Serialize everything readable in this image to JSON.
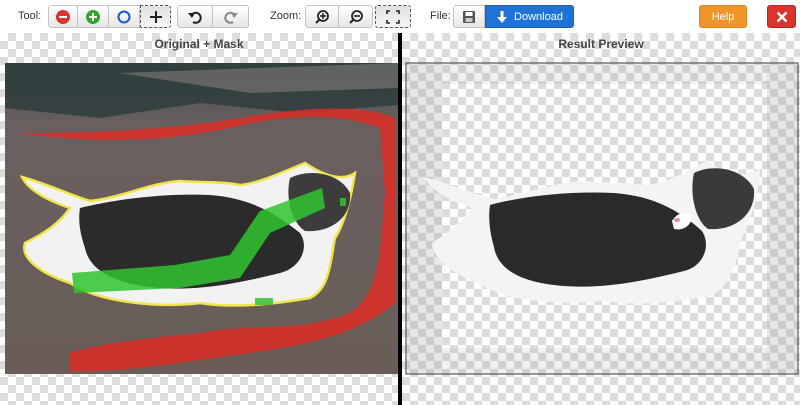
{
  "toolbar": {
    "tool_label": "Tool:",
    "zoom_label": "Zoom:",
    "file_label": "File:",
    "download_label": "Download",
    "help_label": "Help",
    "tools": [
      {
        "name": "remove-tool",
        "icon": "minus-circle-icon",
        "color": "#d9352d"
      },
      {
        "name": "keep-tool",
        "icon": "plus-circle-icon",
        "color": "#2fa52f"
      },
      {
        "name": "outline-tool",
        "icon": "circle-outline-icon",
        "color": "#1f55d8"
      },
      {
        "name": "pan-tool",
        "icon": "move-icon",
        "color": "#222222"
      }
    ],
    "history": [
      "undo-icon",
      "redo-icon"
    ],
    "zoom": [
      "zoom-in-icon",
      "zoom-out-icon",
      "fit-screen-icon"
    ],
    "file": [
      "save-icon",
      "download-icon"
    ],
    "colors": {
      "download": "#1f73d8",
      "help": "#f0952a",
      "close": "#d9352d"
    }
  },
  "left_panel": {
    "title": "Original + Mask"
  },
  "right_panel": {
    "title": "Result Preview"
  }
}
